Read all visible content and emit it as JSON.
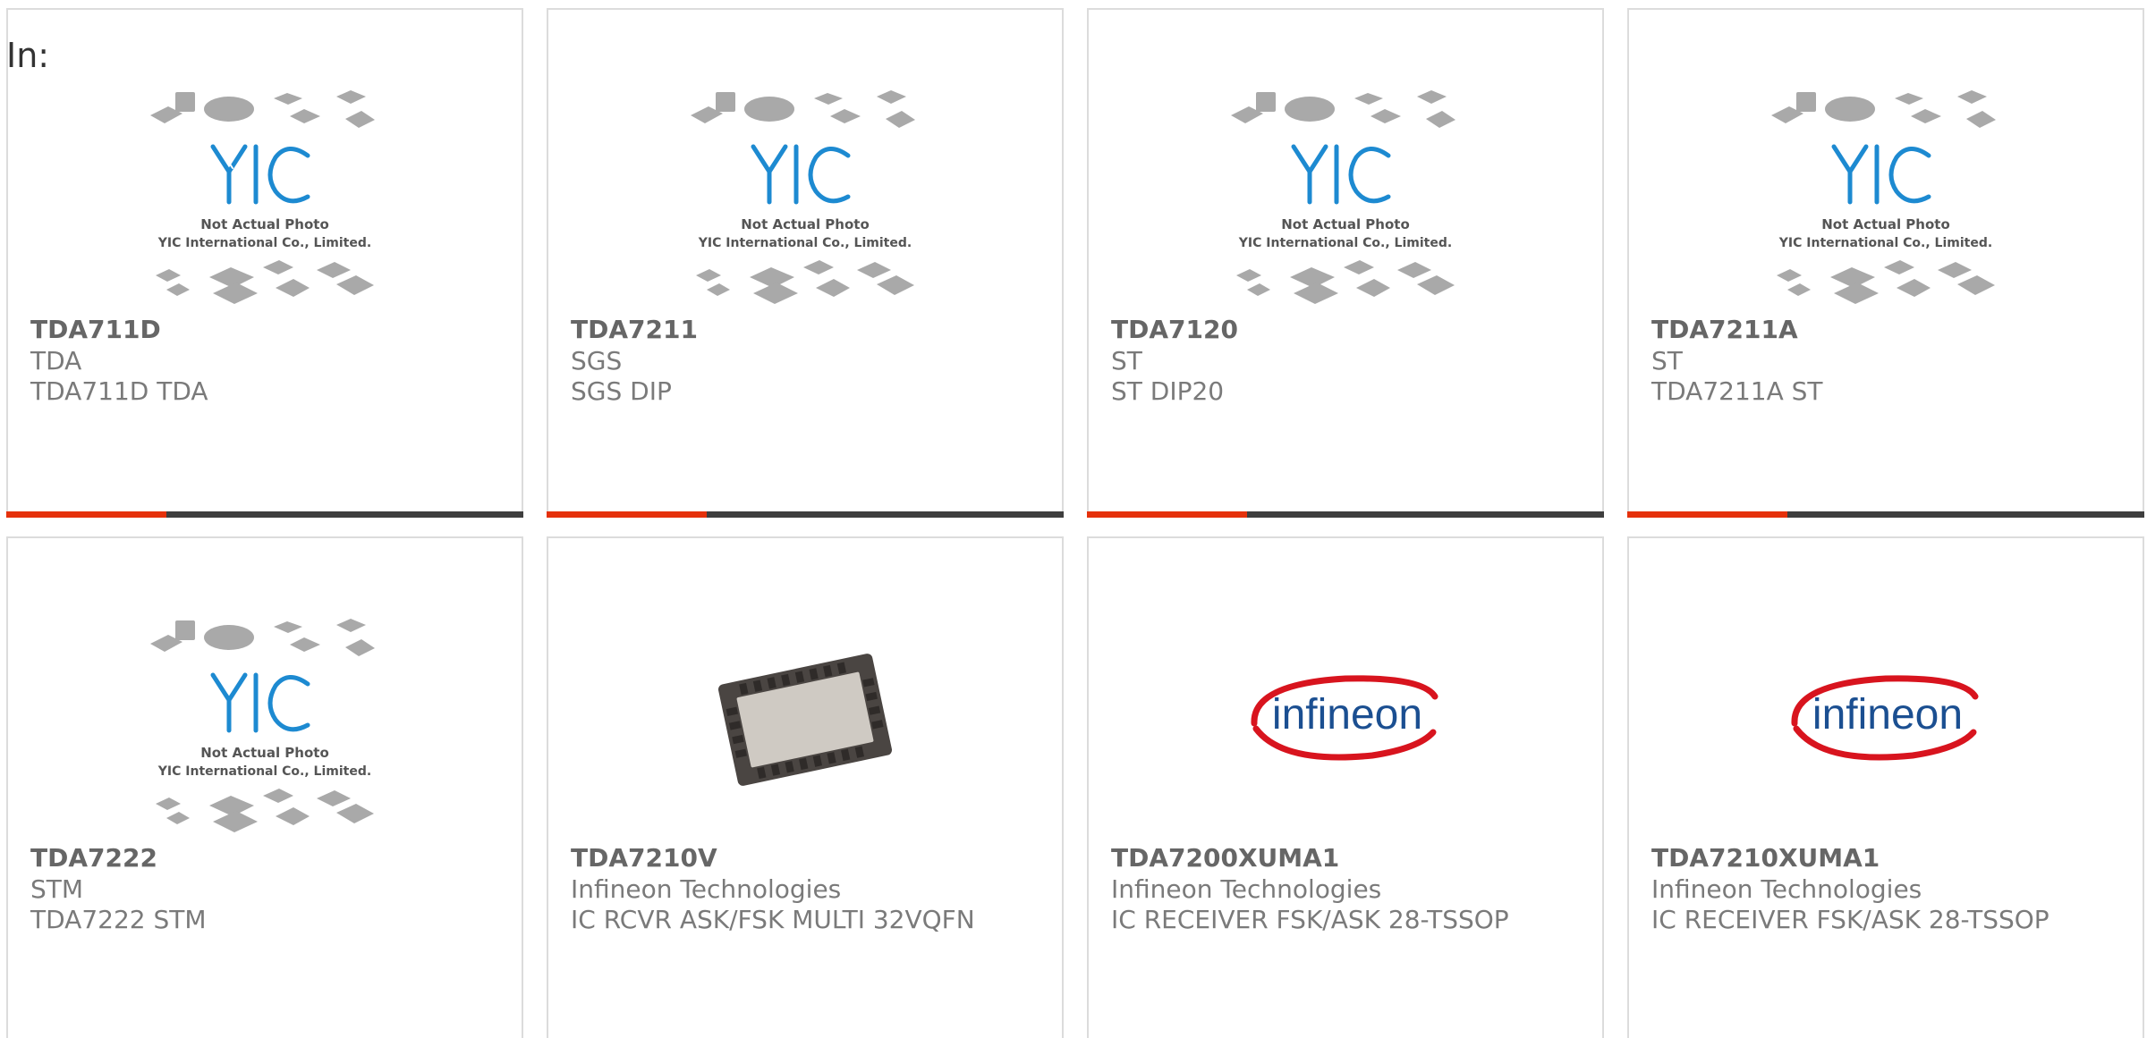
{
  "header": {
    "label": "In:"
  },
  "colors": {
    "accent": "#e5310b",
    "bar": "#3e3e3e",
    "border": "#dcdcdc"
  },
  "products": [
    {
      "part": "TDA711D",
      "maker": "TDA",
      "desc": "TDA711D TDA",
      "image": "yic-placeholder",
      "photo_caption_1": "Not Actual Photo",
      "photo_caption_2": "YIC International Co., Limited.",
      "bar_fill": 0.31
    },
    {
      "part": "TDA7211",
      "maker": "SGS",
      "desc": "SGS DIP",
      "image": "yic-placeholder",
      "photo_caption_1": "Not Actual Photo",
      "photo_caption_2": "YIC International Co., Limited.",
      "bar_fill": 0.31
    },
    {
      "part": "TDA7120",
      "maker": "ST",
      "desc": "ST DIP20",
      "image": "yic-placeholder",
      "photo_caption_1": "Not Actual Photo",
      "photo_caption_2": "YIC International Co., Limited.",
      "bar_fill": 0.31
    },
    {
      "part": "TDA7211A",
      "maker": "ST",
      "desc": "TDA7211A ST",
      "image": "yic-placeholder",
      "photo_caption_1": "Not Actual Photo",
      "photo_caption_2": "YIC International Co., Limited.",
      "bar_fill": 0.31
    },
    {
      "part": "TDA7222",
      "maker": "STM",
      "desc": "TDA7222 STM",
      "image": "yic-placeholder",
      "photo_caption_1": "Not Actual Photo",
      "photo_caption_2": "YIC International Co., Limited."
    },
    {
      "part": "TDA7210V",
      "maker": "Infineon Technologies",
      "desc": "IC RCVR ASK/FSK MULTI 32VQFN",
      "image": "qfn-chip-photo"
    },
    {
      "part": "TDA7200XUMA1",
      "maker": "Infineon Technologies",
      "desc": "IC RECEIVER FSK/ASK 28-TSSOP",
      "image": "infineon-logo",
      "logo_text": "infineon"
    },
    {
      "part": "TDA7210XUMA1",
      "maker": "Infineon Technologies",
      "desc": "IC RECEIVER FSK/ASK 28-TSSOP",
      "image": "infineon-logo",
      "logo_text": "infineon"
    }
  ]
}
